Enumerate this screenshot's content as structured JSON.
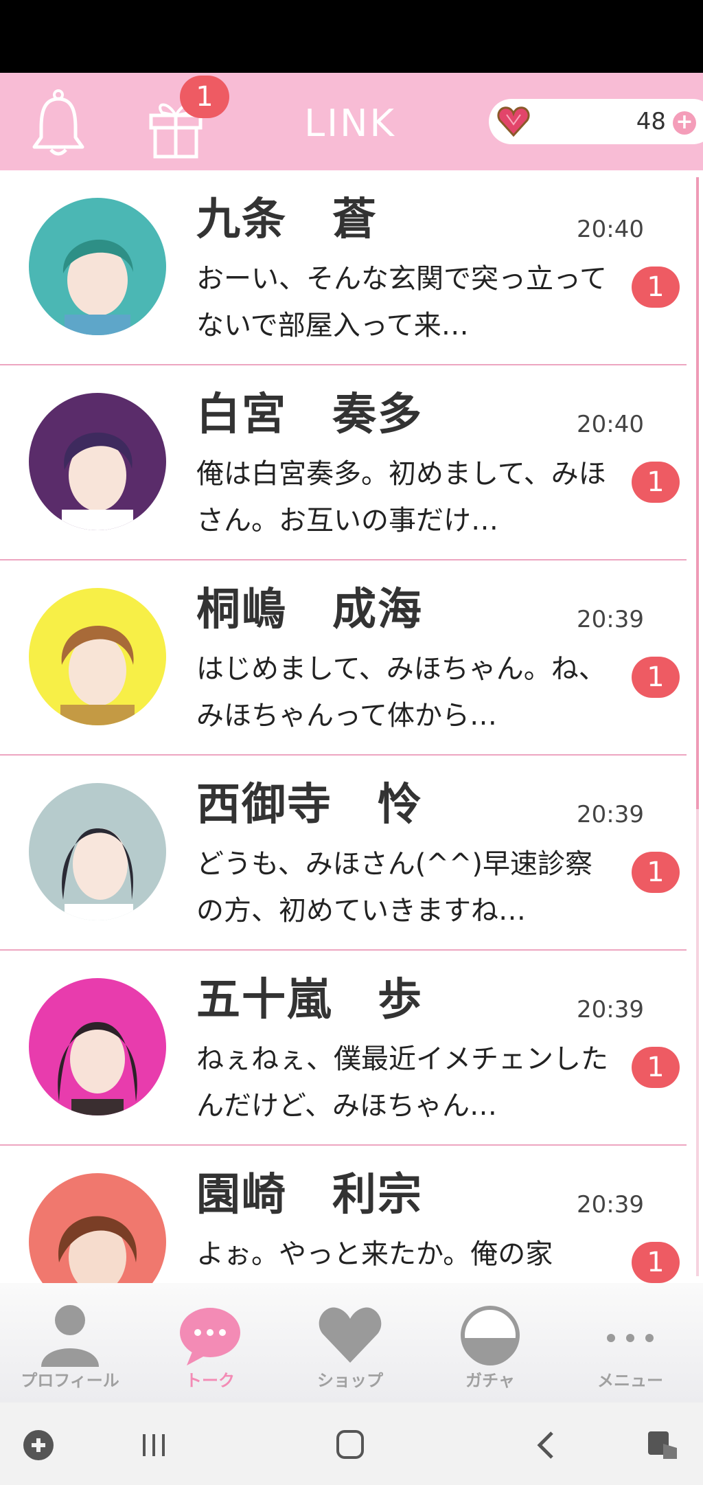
{
  "header": {
    "title": "LINK",
    "gift_badge": "1",
    "gem_count": "48",
    "plus": "+"
  },
  "chats": [
    {
      "name": "九条　蒼",
      "time": "20:40",
      "message": "おーい、そんな玄関で突っ立ってないで部屋入って来…",
      "unread": "1",
      "avatar_color": "#4bb7b4"
    },
    {
      "name": "白宮　奏多",
      "time": "20:40",
      "message": "俺は白宮奏多。初めまして、みほさん。お互いの事だけ…",
      "unread": "1",
      "avatar_color": "#5a2c6a"
    },
    {
      "name": "桐嶋　成海",
      "time": "20:39",
      "message": "はじめまして、みほちゃん。ね、みほちゃんって体から…",
      "unread": "1",
      "avatar_color": "#f7ef47"
    },
    {
      "name": "西御寺　怜",
      "time": "20:39",
      "message": "どうも、みほさん(^^)早速診察の方、初めていきますね…",
      "unread": "1",
      "avatar_color": "#b6cbcc"
    },
    {
      "name": "五十嵐　歩",
      "time": "20:39",
      "message": "ねぇねぇ、僕最近イメチェンしたんだけど、みほちゃん…",
      "unread": "1",
      "avatar_color": "#e83cad"
    },
    {
      "name": "園崎　利宗",
      "time": "20:39",
      "message": "よぉ。やっと来たか。俺の家",
      "unread": "1",
      "avatar_color": "#f0786e"
    }
  ],
  "nav": {
    "profile": "プロフィール",
    "talk": "トーク",
    "shop": "ショップ",
    "gacha": "ガチャ",
    "menu": "メニュー"
  },
  "colors": {
    "header_pink": "#f8bcd5",
    "badge_red": "#ee5b63",
    "active_pink": "#f38bb5"
  }
}
